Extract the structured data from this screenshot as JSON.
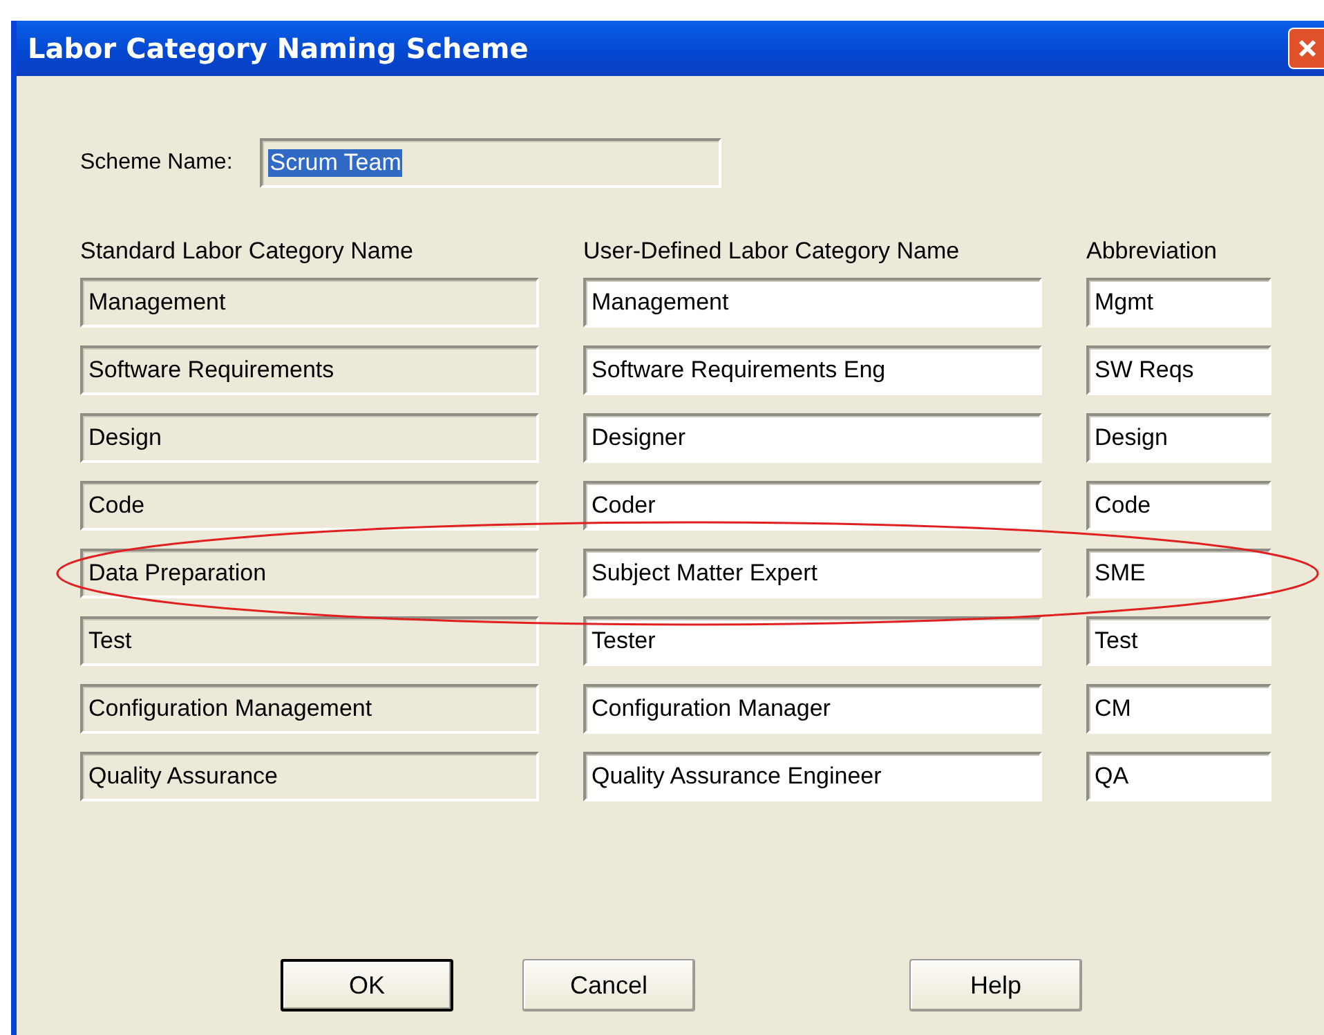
{
  "window": {
    "title": "Labor Category Naming Scheme"
  },
  "scheme_name": {
    "label": "Scheme Name:",
    "value": "Scrum Team",
    "text_selected": true
  },
  "columns": [
    "Standard Labor Category Name",
    "User-Defined Labor Category Name",
    "Abbreviation"
  ],
  "rows": [
    {
      "standard": "Management",
      "user_defined": "Management",
      "abbreviation": "Mgmt",
      "highlighted": false
    },
    {
      "standard": "Software Requirements",
      "user_defined": "Software Requirements Eng",
      "abbreviation": "SW Reqs",
      "highlighted": false
    },
    {
      "standard": "Design",
      "user_defined": "Designer",
      "abbreviation": "Design",
      "highlighted": false
    },
    {
      "standard": "Code",
      "user_defined": "Coder",
      "abbreviation": "Code",
      "highlighted": false
    },
    {
      "standard": "Data Preparation",
      "user_defined": "Subject Matter Expert",
      "abbreviation": "SME",
      "highlighted": true
    },
    {
      "standard": "Test",
      "user_defined": "Tester",
      "abbreviation": "Test",
      "highlighted": false
    },
    {
      "standard": "Configuration Management",
      "user_defined": "Configuration Manager",
      "abbreviation": "CM",
      "highlighted": false
    },
    {
      "standard": "Quality Assurance",
      "user_defined": "Quality Assurance Engineer",
      "abbreviation": "QA",
      "highlighted": false
    }
  ],
  "buttons": [
    {
      "label": "OK",
      "default": true
    },
    {
      "label": "Cancel",
      "default": false
    },
    {
      "label": "Help",
      "default": false
    }
  ]
}
